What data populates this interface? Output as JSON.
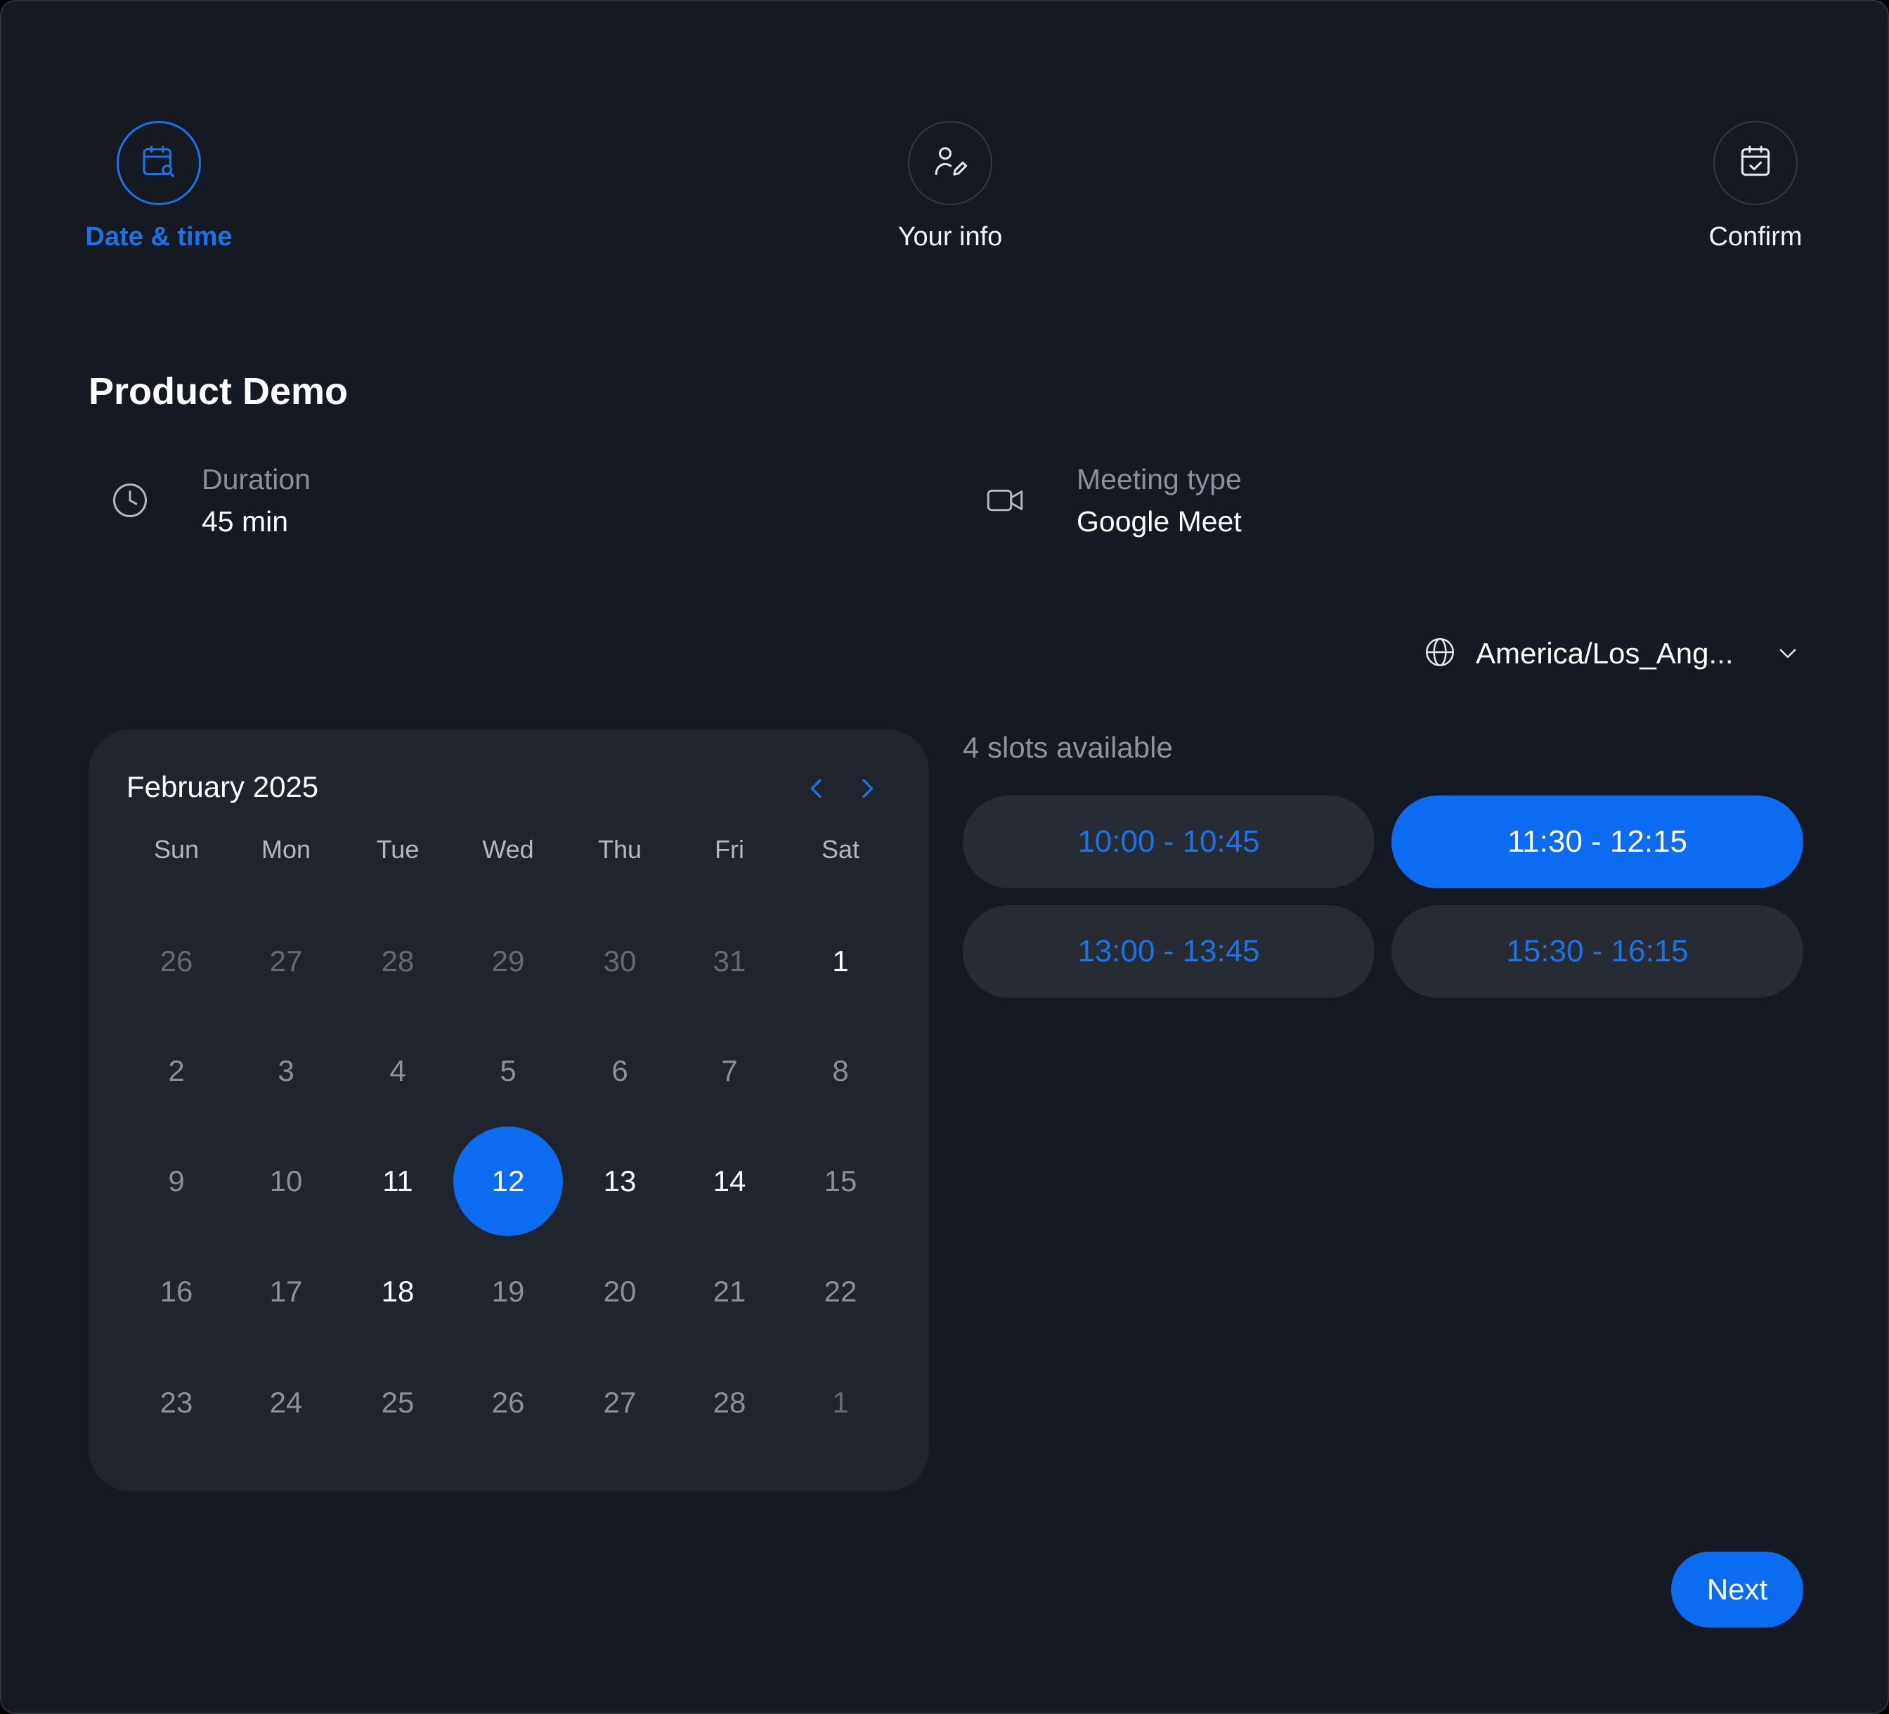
{
  "steps": [
    {
      "label": "Date & time",
      "icon": "calendar-search-icon",
      "state": "active"
    },
    {
      "label": "Your info",
      "icon": "user-edit-icon",
      "state": "pending"
    },
    {
      "label": "Confirm",
      "icon": "calendar-check-icon",
      "state": "pending"
    }
  ],
  "event": {
    "title": "Product Demo",
    "duration_label": "Duration",
    "duration_value": "45 min",
    "meeting_type_label": "Meeting type",
    "meeting_type_value": "Google Meet"
  },
  "timezone": {
    "value": "America/Los_Ang...",
    "icon": "globe-icon"
  },
  "calendar": {
    "month_label": "February 2025",
    "weekdays": [
      "Sun",
      "Mon",
      "Tue",
      "Wed",
      "Thu",
      "Fri",
      "Sat"
    ],
    "weeks": [
      [
        {
          "d": "26",
          "s": "outside"
        },
        {
          "d": "27",
          "s": "outside"
        },
        {
          "d": "28",
          "s": "outside"
        },
        {
          "d": "29",
          "s": "outside"
        },
        {
          "d": "30",
          "s": "outside"
        },
        {
          "d": "31",
          "s": "outside"
        },
        {
          "d": "1",
          "s": "available"
        }
      ],
      [
        {
          "d": "2",
          "s": "disabled"
        },
        {
          "d": "3",
          "s": "disabled"
        },
        {
          "d": "4",
          "s": "disabled"
        },
        {
          "d": "5",
          "s": "disabled"
        },
        {
          "d": "6",
          "s": "disabled"
        },
        {
          "d": "7",
          "s": "disabled"
        },
        {
          "d": "8",
          "s": "disabled"
        }
      ],
      [
        {
          "d": "9",
          "s": "disabled"
        },
        {
          "d": "10",
          "s": "disabled"
        },
        {
          "d": "11",
          "s": "available"
        },
        {
          "d": "12",
          "s": "selected"
        },
        {
          "d": "13",
          "s": "available"
        },
        {
          "d": "14",
          "s": "available"
        },
        {
          "d": "15",
          "s": "disabled"
        }
      ],
      [
        {
          "d": "16",
          "s": "disabled"
        },
        {
          "d": "17",
          "s": "disabled"
        },
        {
          "d": "18",
          "s": "available"
        },
        {
          "d": "19",
          "s": "disabled"
        },
        {
          "d": "20",
          "s": "disabled"
        },
        {
          "d": "21",
          "s": "disabled"
        },
        {
          "d": "22",
          "s": "disabled"
        }
      ],
      [
        {
          "d": "23",
          "s": "disabled"
        },
        {
          "d": "24",
          "s": "disabled"
        },
        {
          "d": "25",
          "s": "disabled"
        },
        {
          "d": "26",
          "s": "disabled"
        },
        {
          "d": "27",
          "s": "disabled"
        },
        {
          "d": "28",
          "s": "disabled"
        },
        {
          "d": "1",
          "s": "outside"
        }
      ]
    ]
  },
  "slots": {
    "count_label": "4 slots available",
    "items": [
      {
        "label": "10:00 - 10:45",
        "selected": false
      },
      {
        "label": "11:30 - 12:15",
        "selected": true
      },
      {
        "label": "13:00 - 13:45",
        "selected": false
      },
      {
        "label": "15:30 - 16:15",
        "selected": false
      }
    ]
  },
  "actions": {
    "next_label": "Next"
  },
  "colors": {
    "background": "#151922",
    "panel": "#1f242d",
    "accent": "#0b6cf2",
    "accent_text": "#1a73e8",
    "muted_text": "#8b919c"
  }
}
